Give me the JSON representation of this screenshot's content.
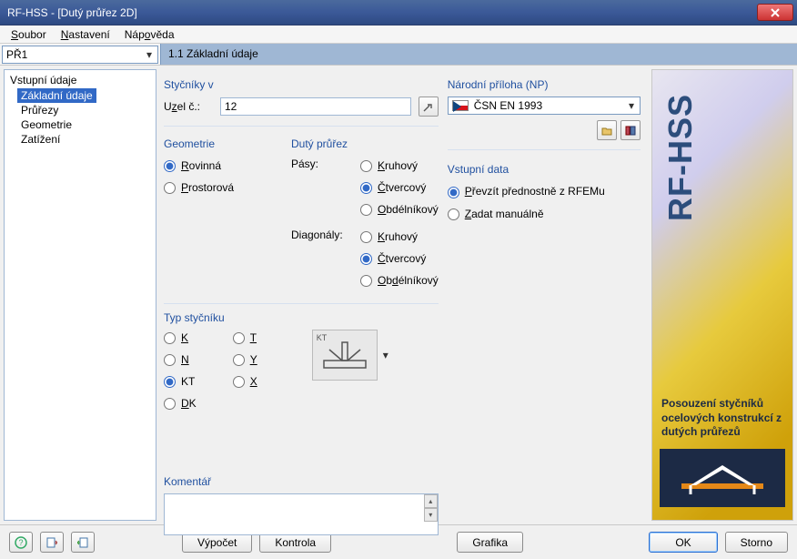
{
  "window": {
    "title": "RF-HSS - [Dutý průřez 2D]"
  },
  "menu": {
    "file": "Soubor",
    "settings": "Nastavení",
    "help": "Nápověda"
  },
  "toolbar": {
    "case": "PŘ1",
    "heading": "1.1 Základní údaje"
  },
  "tree": {
    "root": "Vstupní údaje",
    "items": [
      "Základní údaje",
      "Průřezy",
      "Geometrie",
      "Zatížení"
    ],
    "selected": 0
  },
  "joints": {
    "legend": "Styčníky v",
    "node_label_pre": "U",
    "node_label_ul": "z",
    "node_label_post": "el č.:",
    "node_value": "12"
  },
  "national": {
    "legend": "Národní příloha (NP)",
    "value": "ČSN EN 1993"
  },
  "geometry": {
    "legend": "Geometrie",
    "options": [
      {
        "label_ul": "R",
        "label_rest": "ovinná",
        "checked": true
      },
      {
        "label_ul": "P",
        "label_rest": "rostorová",
        "checked": false
      }
    ]
  },
  "hollow": {
    "legend": "Dutý průřez",
    "rows": [
      {
        "label": "Pásy:",
        "options": [
          {
            "ul": "K",
            "rest": "ruhový",
            "checked": false
          },
          {
            "ul": "Č",
            "rest": "tvercový",
            "checked": true
          },
          {
            "ul": "O",
            "rest": "bdélníkový",
            "checked": false
          }
        ]
      },
      {
        "label": "Diagonály:",
        "options": [
          {
            "ul": "K",
            "rest": "ruhový",
            "checked": false
          },
          {
            "ul": "Č",
            "rest": "tvercový",
            "checked": true
          },
          {
            "ul": "O",
            "rest": "b",
            "rest2": "d",
            "rest3": "élníkový",
            "checked": false
          }
        ]
      }
    ]
  },
  "input_data": {
    "legend": "Vstupní data",
    "opt1_ul": "P",
    "opt1_rest": "řevzít přednostně z RFEMu",
    "opt2_ul": "Z",
    "opt2_rest": "adat manuálně",
    "selected": 0
  },
  "joint_type": {
    "legend": "Typ styčníku",
    "col1": [
      {
        "ul": "K",
        "rest": "",
        "checked": false
      },
      {
        "ul": "N",
        "rest": "",
        "checked": false
      },
      {
        "label": "KT",
        "checked": true
      },
      {
        "ul": "D",
        "rest": "K",
        "checked": false
      }
    ],
    "col2": [
      {
        "ul": "T",
        "rest": "",
        "checked": false
      },
      {
        "ul": "Y",
        "rest": "",
        "checked": false
      },
      {
        "ul": "X",
        "rest": "",
        "checked": false
      }
    ],
    "thumb_label": "KT"
  },
  "comment": {
    "legend": "Komentář",
    "value": ""
  },
  "banner": {
    "title": "RF-HSS",
    "text": "Posouzení styčníků ocelových konstrukcí z dutých průřezů"
  },
  "footer": {
    "calc": "Výpočet",
    "check": "Kontrola",
    "graphics": "Grafika",
    "ok": "OK",
    "cancel": "Storno"
  }
}
